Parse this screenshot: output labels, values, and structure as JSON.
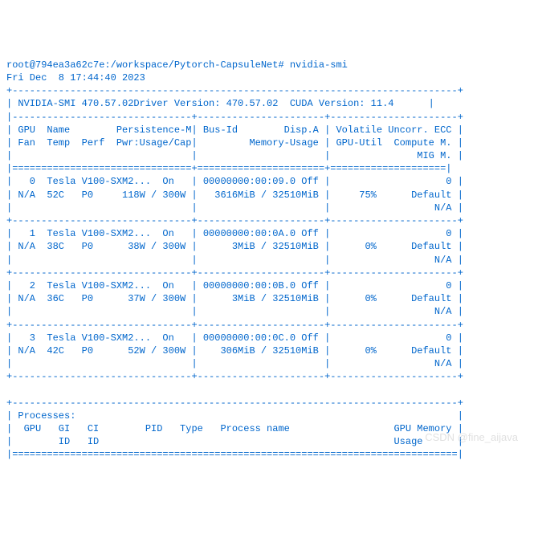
{
  "prompt": {
    "user_host": "root@794ea3a62c7e",
    "path": "/workspace/Pytorch-CapsuleNet",
    "command": "nvidia-smi"
  },
  "timestamp": "Fri Dec  8 17:44:40 2023",
  "header": {
    "smi_version": "NVIDIA-SMI 470.57.02",
    "driver_version": "Driver Version: 470.57.02",
    "cuda_version": "CUDA Version: 11.4"
  },
  "column_headers": {
    "row1_left": "GPU  Name        Persistence-M",
    "row1_mid": "Bus-Id        Disp.A",
    "row1_right": "Volatile Uncorr. ECC",
    "row2_left": "Fan  Temp  Perf  Pwr:Usage/Cap",
    "row2_mid": "         Memory-Usage",
    "row2_right": "GPU-Util  Compute M.",
    "row3_right": "              MIG M."
  },
  "gpus": [
    {
      "idx": "0",
      "name": "Tesla V100-SXM2...",
      "persist": "On",
      "bus_id": "00000000:00:09.0",
      "disp": "Off",
      "ecc": "0",
      "fan": "N/A",
      "temp": "52C",
      "perf": "P0",
      "pwr": "118W / 300W",
      "mem": "3616MiB / 32510MiB",
      "util": "75%",
      "compute": "Default",
      "mig": "N/A"
    },
    {
      "idx": "1",
      "name": "Tesla V100-SXM2...",
      "persist": "On",
      "bus_id": "00000000:00:0A.0",
      "disp": "Off",
      "ecc": "0",
      "fan": "N/A",
      "temp": "38C",
      "perf": "P0",
      "pwr": "38W / 300W",
      "mem": "3MiB / 32510MiB",
      "util": "0%",
      "compute": "Default",
      "mig": "N/A"
    },
    {
      "idx": "2",
      "name": "Tesla V100-SXM2...",
      "persist": "On",
      "bus_id": "00000000:00:0B.0",
      "disp": "Off",
      "ecc": "0",
      "fan": "N/A",
      "temp": "36C",
      "perf": "P0",
      "pwr": "37W / 300W",
      "mem": "3MiB / 32510MiB",
      "util": "0%",
      "compute": "Default",
      "mig": "N/A"
    },
    {
      "idx": "3",
      "name": "Tesla V100-SXM2...",
      "persist": "On",
      "bus_id": "00000000:00:0C.0",
      "disp": "Off",
      "ecc": "0",
      "fan": "N/A",
      "temp": "42C",
      "perf": "P0",
      "pwr": "52W / 300W",
      "mem": "306MiB / 32510MiB",
      "util": "0%",
      "compute": "Default",
      "mig": "N/A"
    }
  ],
  "processes": {
    "title": "Processes:",
    "header1": "  GPU   GI   CI        PID   Type   Process name                  GPU Memory ",
    "header2": "        ID   ID                                                   Usage      "
  },
  "watermark": "CSDN @fine_aijava"
}
